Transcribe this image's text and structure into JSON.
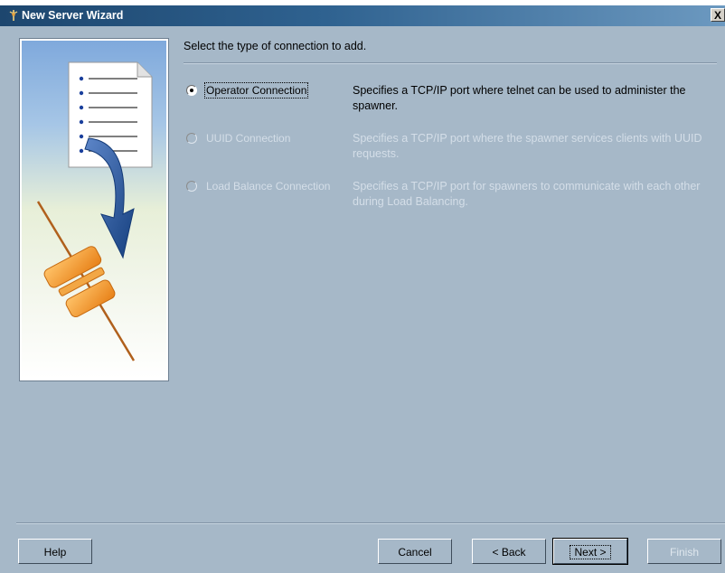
{
  "window": {
    "title": "New Server Wizard",
    "close_label": "X"
  },
  "instruction": "Select the type of connection to add.",
  "options": [
    {
      "label": "Operator Connection",
      "description": "Specifies a TCP/IP port where telnet can be used to administer the spawner.",
      "selected": true,
      "enabled": true
    },
    {
      "label": "UUID Connection",
      "description": "Specifies a TCP/IP port where the spawner services clients with UUID requests.",
      "selected": false,
      "enabled": false
    },
    {
      "label": "Load Balance Connection",
      "description": "Specifies a TCP/IP port for spawners to communicate with each other during Load Balancing.",
      "selected": false,
      "enabled": false
    }
  ],
  "buttons": {
    "help": "Help",
    "cancel": "Cancel",
    "back": "< Back",
    "next": "Next >",
    "finish": "Finish"
  },
  "colors": {
    "dialog_bg": "#a6b8c8",
    "titlebar_start": "#1d466e",
    "titlebar_end": "#6c99c0",
    "disabled_text": "#d4dee8"
  },
  "icons": {
    "title": "server-wizard-icon",
    "illustration": "document-arrow-plug-illustration"
  }
}
